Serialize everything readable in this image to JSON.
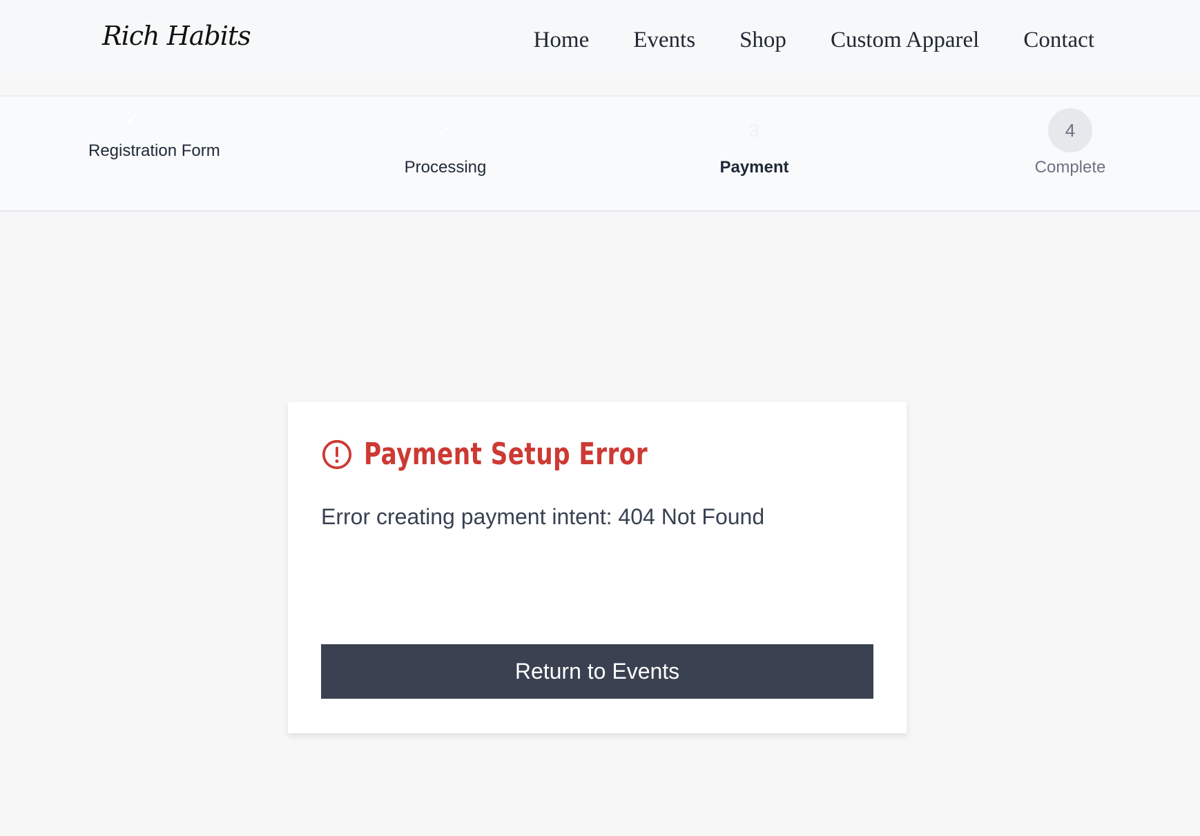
{
  "header": {
    "logo": "Rich Habits",
    "nav": [
      {
        "label": "Home"
      },
      {
        "label": "Events"
      },
      {
        "label": "Shop"
      },
      {
        "label": "Custom Apparel"
      },
      {
        "label": "Contact"
      }
    ]
  },
  "stepper": {
    "steps": [
      {
        "label": "Registration Form",
        "marker": "✓",
        "state": "completed"
      },
      {
        "label": "Processing",
        "marker": "✓",
        "state": "completed"
      },
      {
        "label": "Payment",
        "marker": "3",
        "state": "current"
      },
      {
        "label": "Complete",
        "marker": "4",
        "state": "pending"
      }
    ]
  },
  "error": {
    "icon": "alert-circle-icon",
    "title": "Payment Setup Error",
    "message": "Error creating payment intent: 404 Not Found",
    "button_label": "Return to Events"
  },
  "colors": {
    "error": "#cc3a33",
    "button": "#3a4150",
    "page_background": "#f7f7f8"
  }
}
